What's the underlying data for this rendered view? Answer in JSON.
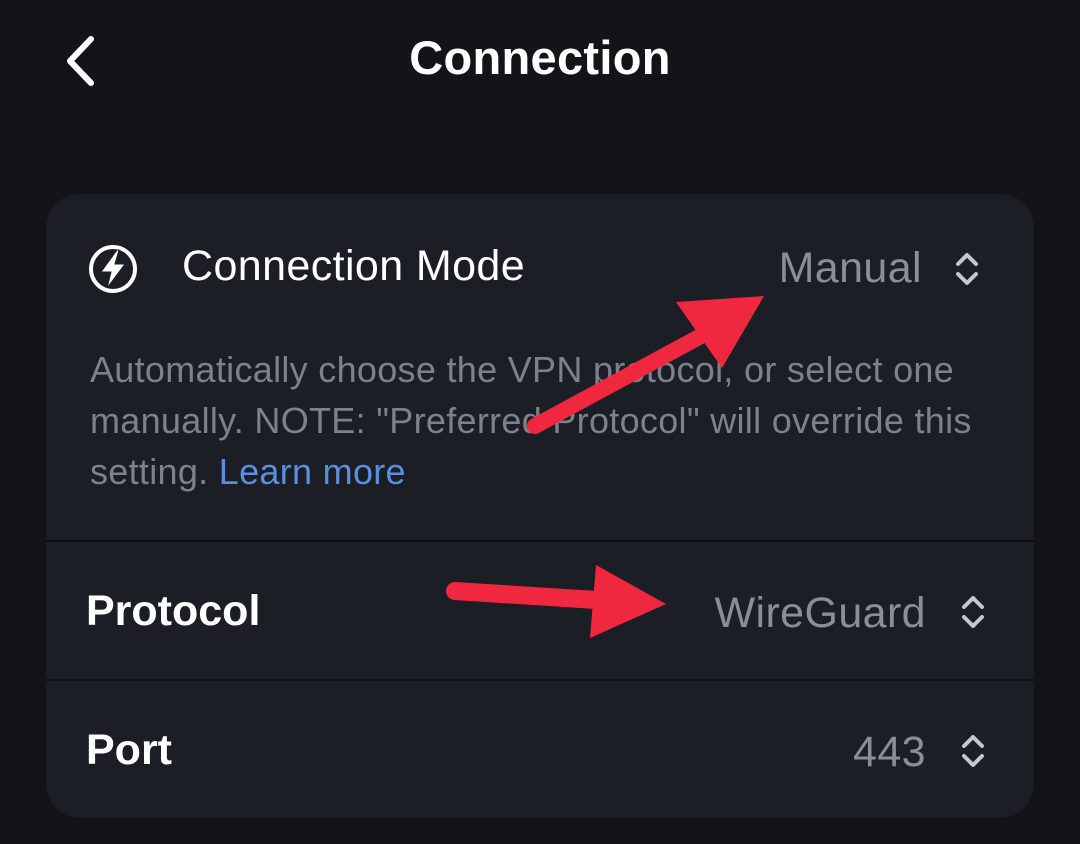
{
  "header": {
    "title": "Connection",
    "back_icon": "chevron-left-icon"
  },
  "connection_mode": {
    "icon": "lightning-bolt-icon",
    "label": "Connection Mode",
    "value": "Manual",
    "selector_icon": "up-down-chevron-icon",
    "description": "Automatically choose the VPN protocol, or select one manually. NOTE: \"Preferred Protocol\" will override this setting.",
    "learn_more": "Learn more"
  },
  "protocol": {
    "label": "Protocol",
    "value": "WireGuard",
    "selector_icon": "up-down-chevron-icon"
  },
  "port": {
    "label": "Port",
    "value": "443",
    "selector_icon": "up-down-chevron-icon"
  },
  "colors": {
    "background": "#121418",
    "card": "#1b1e24",
    "muted_text": "#8a8e97",
    "link": "#5a8fe0",
    "annotation_arrow": "#f0283f"
  }
}
